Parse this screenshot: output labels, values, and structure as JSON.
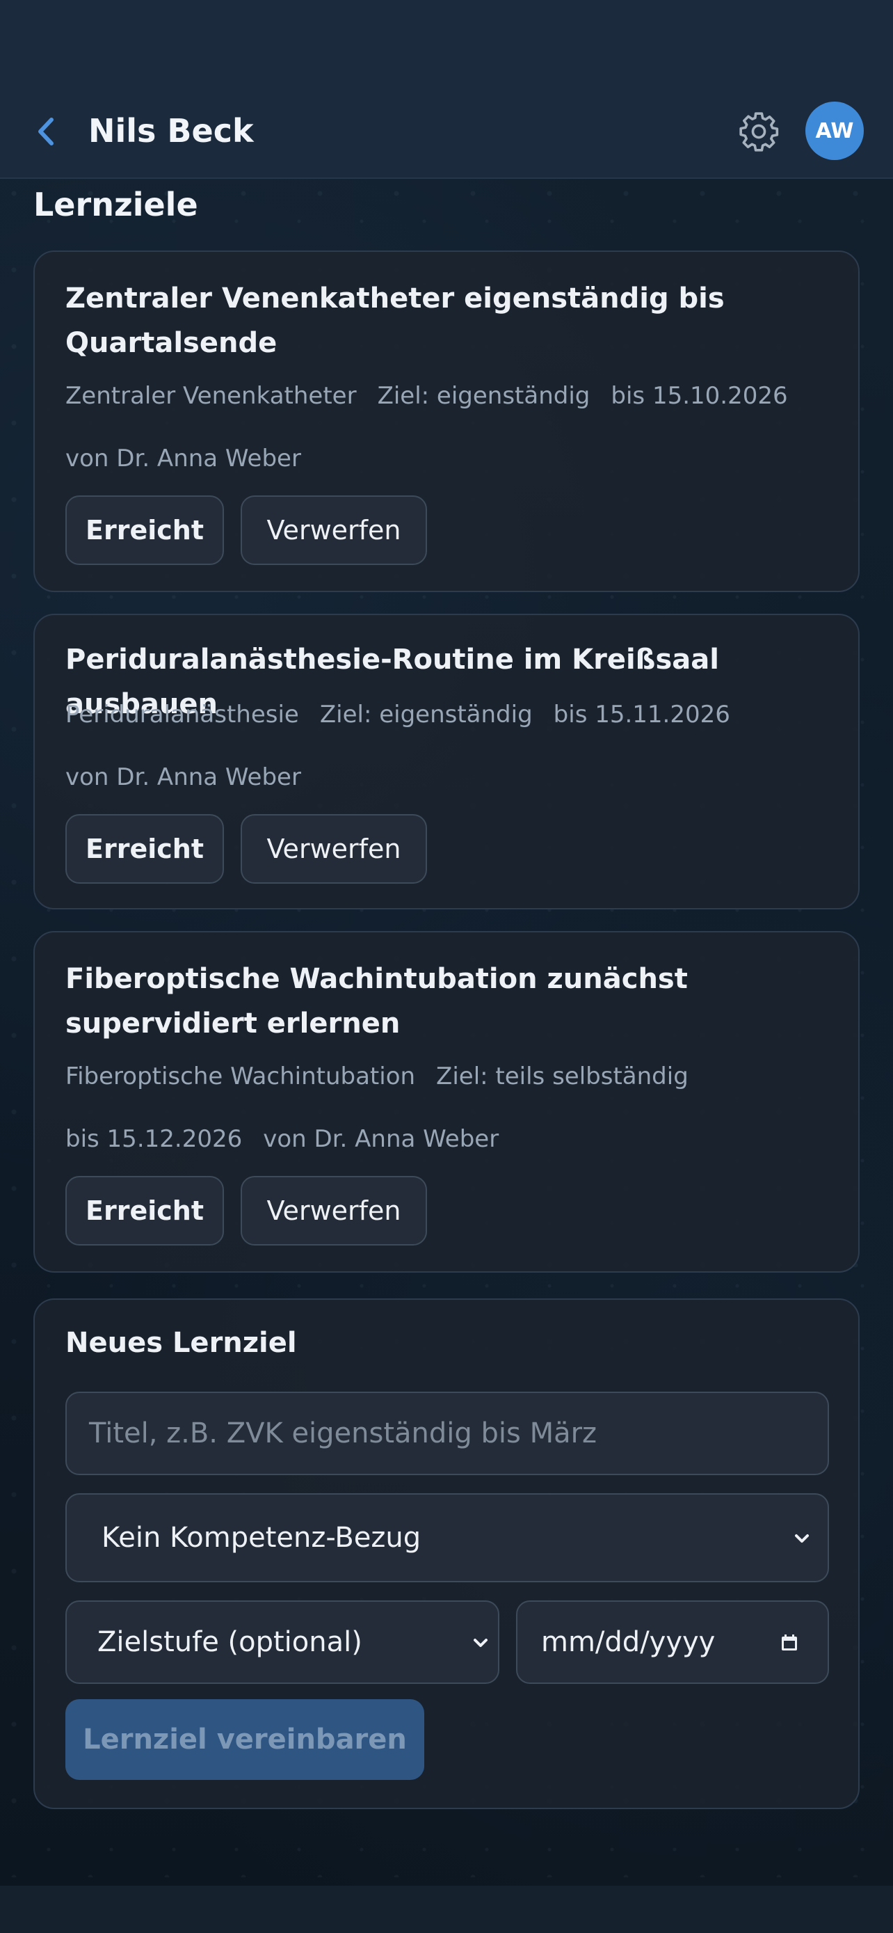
{
  "header": {
    "title": "Nils Beck",
    "avatar_initials": "AW",
    "accent_color": "#3e8ad9"
  },
  "section": {
    "title": "Lernziele"
  },
  "goals": [
    {
      "title": "Zentraler Venenkatheter eigenständig bis Quartalsende",
      "competence": "Zentraler Venenkatheter",
      "target": "Ziel: eigenständig",
      "due": "bis 15.10.2026",
      "author": "von Dr. Anna Weber",
      "achieved_label": "Erreicht",
      "discard_label": "Verwerfen"
    },
    {
      "title": "Periduralanästhesie-Routine im Kreißsaal ausbauen",
      "competence": "Periduralanästhesie",
      "target": "Ziel: eigenständig",
      "due": "bis 15.11.2026",
      "author": "von Dr. Anna Weber",
      "achieved_label": "Erreicht",
      "discard_label": "Verwerfen"
    },
    {
      "title": "Fiberoptische Wachintubation zunächst supervidiert erlernen",
      "competence": "Fiberoptische Wachintubation",
      "target": "Ziel: teils selbständig",
      "due": "bis 15.12.2026",
      "author": "von Dr. Anna Weber",
      "achieved_label": "Erreicht",
      "discard_label": "Verwerfen"
    }
  ],
  "new_goal": {
    "title": "Neues Lernziel",
    "title_placeholder": "Titel, z.B. ZVK eigenständig bis März",
    "competence_select": "Kein Kompetenz-Bezug",
    "level_select": "Zielstufe (optional)",
    "date_placeholder": "mm/dd/yyyy",
    "submit_label": "Lernziel vereinbaren"
  }
}
